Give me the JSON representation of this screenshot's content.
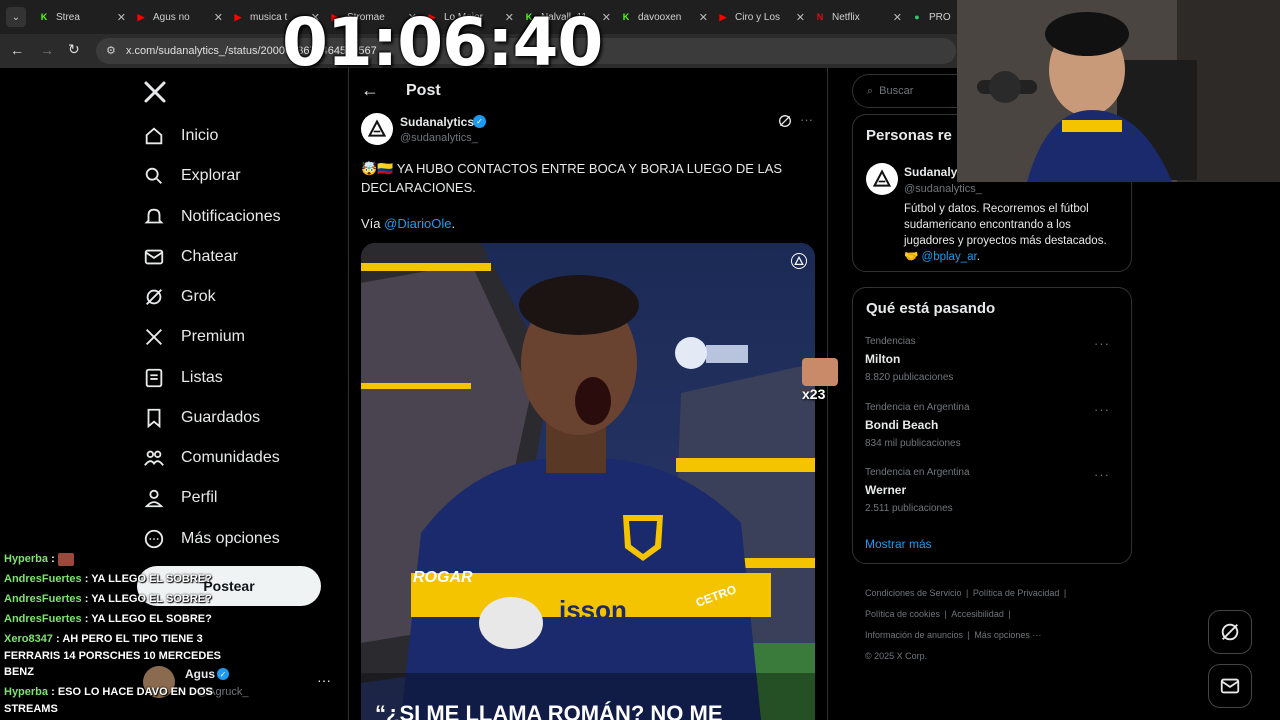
{
  "browser": {
    "tabs": [
      {
        "label": "Strea",
        "fav": "K",
        "fav_color": "#53fc18"
      },
      {
        "label": "Agus no",
        "fav": "▶",
        "fav_color": "#ff0000"
      },
      {
        "label": "musica t",
        "fav": "▶",
        "fav_color": "#ff0000"
      },
      {
        "label": "Stromae",
        "fav": "▶",
        "fav_color": "#ff0000"
      },
      {
        "label": "Lo Mejor",
        "fav": "▶",
        "fav_color": "#ff0000"
      },
      {
        "label": "Nalvall_11",
        "fav": "K",
        "fav_color": "#53fc18"
      },
      {
        "label": "davooxen",
        "fav": "K",
        "fav_color": "#53fc18"
      },
      {
        "label": "Ciro y Los",
        "fav": "▶",
        "fav_color": "#ff0000"
      },
      {
        "label": "Netflix",
        "fav": "N",
        "fav_color": "#e50914"
      },
      {
        "label": "PRO",
        "fav": "●",
        "fav_color": "#2ecc71"
      }
    ],
    "url": "x.com/sudanalytics_/status/2000683673464540567"
  },
  "overlay_timer": "01:06:40",
  "nav": {
    "items": [
      {
        "label": "Inicio",
        "icon": "home-icon"
      },
      {
        "label": "Explorar",
        "icon": "search-icon"
      },
      {
        "label": "Notificaciones",
        "icon": "bell-icon"
      },
      {
        "label": "Chatear",
        "icon": "mail-icon"
      },
      {
        "label": "Grok",
        "icon": "grok-icon"
      },
      {
        "label": "Premium",
        "icon": "x-icon"
      },
      {
        "label": "Listas",
        "icon": "list-icon"
      },
      {
        "label": "Guardados",
        "icon": "bookmark-icon"
      },
      {
        "label": "Comunidades",
        "icon": "people-icon"
      },
      {
        "label": "Perfil",
        "icon": "person-icon"
      },
      {
        "label": "Más opciones",
        "icon": "more-icon"
      }
    ],
    "post_button": "Postear",
    "account": {
      "name": "Agus",
      "handle": "@Agruck_"
    }
  },
  "post": {
    "header_title": "Post",
    "author_name": "Sudanalytics",
    "author_handle": "@sudanalytics_",
    "text_emoji": "🤯🇨🇴",
    "text_line": "YA HUBO CONTACTOS ENTRE BOCA Y BORJA LUEGO DE LAS DECLARACIONES.",
    "via_label": "Vía",
    "via_link": "@DiarioOle",
    "via_end": ".",
    "image_caption": "“¿SI ME LLAMA ROMÁN? NO ME",
    "jersey_text": "ROGAR",
    "jersey_sponsor": "isson",
    "jersey_sleeve": "CETRO",
    "side_badge": "x23"
  },
  "right": {
    "search_placeholder": "Buscar",
    "who_title": "Personas re",
    "who_name": "Sudanaly",
    "who_handle": "@sudanalytics_",
    "who_bio": "Fútbol y datos. Recorremos el fútbol sudamericano encontrando a los jugadores y proyectos más destacados.",
    "who_bio_emoji": "🤝",
    "who_bio_link": "@bplay_ar",
    "who_bio_end": ".",
    "trends_title": "Qué está pasando",
    "trends": [
      {
        "category": "Tendencias",
        "name": "Milton",
        "count": "8.820 publicaciones"
      },
      {
        "category": "Tendencia en Argentina",
        "name": "Bondi Beach",
        "count": "834 mil publicaciones"
      },
      {
        "category": "Tendencia en Argentina",
        "name": "Werner",
        "count": "2.511 publicaciones"
      }
    ],
    "show_more": "Mostrar más",
    "footer": {
      "terms": "Condiciones de Servicio",
      "privacy": "Política de Privacidad",
      "cookies": "Política de cookies",
      "accessibility": "Accesibilidad",
      "ads": "Información de anuncios",
      "more": "Más opciones ···",
      "copyright": "© 2025 X Corp."
    }
  },
  "chat": [
    {
      "user": "Hyperba",
      "sep": " : ",
      "msg": ""
    },
    {
      "user": "AndresFuertes",
      "sep": " : ",
      "msg": "YA LLEGO EL SOBRE?"
    },
    {
      "user": "AndresFuertes",
      "sep": " : ",
      "msg": "YA LLEGO EL SOBRE?"
    },
    {
      "user": "AndresFuertes",
      "sep": " : ",
      "msg": "YA LLEGO EL SOBRE?"
    },
    {
      "user": "Xero8347",
      "sep": " : ",
      "msg": "AH PERO EL TIPO TIENE 3"
    },
    {
      "user": "",
      "sep": "",
      "msg": "FERRARIS 14 PORSCHES 10 MERCEDES"
    },
    {
      "user": "",
      "sep": "",
      "msg": "BENZ"
    },
    {
      "user": "Hyperba",
      "sep": " : ",
      "msg": "ESO LO HACE DAVO EN DOS"
    },
    {
      "user": "",
      "sep": "",
      "msg": "STREAMS"
    }
  ],
  "colors": {
    "accent": "#1d9bf0",
    "background": "#000000",
    "border": "#2f3336",
    "boca_blue": "#1a2a6c",
    "boca_gold": "#f5c400"
  }
}
